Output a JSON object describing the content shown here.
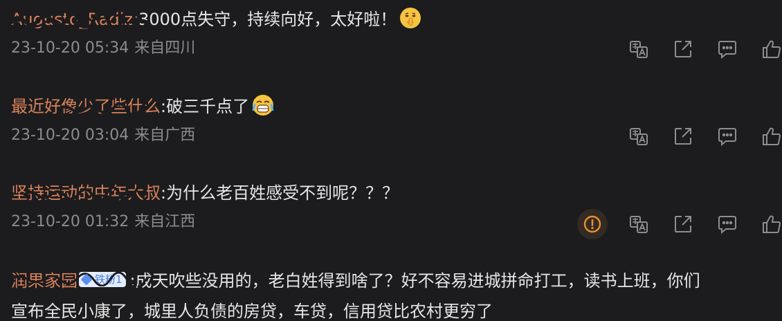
{
  "comments": [
    {
      "username": "Augusto_Radiz",
      "text": ":3000点失守，持续向好，太好啦！",
      "time": "23-10-20 05:34",
      "location": "来自四川"
    },
    {
      "username": "最近好像少了些什么",
      "text": ":破三千点了",
      "time": "23-10-20 03:04",
      "location": "来自广西"
    },
    {
      "username": "坚持运动的中年大叔",
      "text": ":为什么老百姓感受不到呢？？？",
      "time": "23-10-20 01:32",
      "location": "来自江西"
    },
    {
      "username": "润果家园",
      "badge": "铁粉1",
      "text_line1": ":成天吹些没用的，老白姓得到啥了？好不容易进城拼命打工，读书上班，你们",
      "text_line2": "宣布全民小康了，城里人负债的房贷，车贷，信用贷比农村更穷了"
    }
  ],
  "icons": {
    "translate": "translate-icon",
    "share": "share-icon",
    "reply": "reply-icon",
    "like": "like-icon",
    "report": "report-icon"
  },
  "colors": {
    "background": "#1c1c1e",
    "username": "#d9825a",
    "text": "#e6e6e6",
    "meta": "#8c8c8c",
    "icon": "#8e8e8e",
    "report": "#e8902c"
  }
}
